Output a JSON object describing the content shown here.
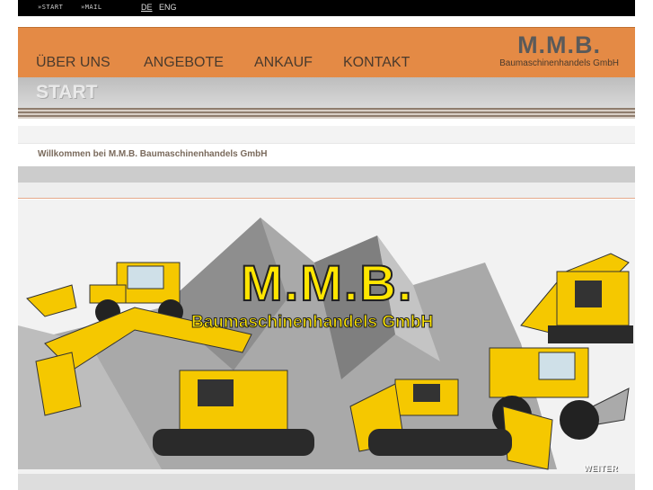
{
  "topbar": {
    "links": [
      {
        "label": "»START"
      },
      {
        "label": "»MAIL"
      }
    ],
    "languages": [
      {
        "label": "DE",
        "active": true
      },
      {
        "label": "ENG",
        "active": false
      }
    ]
  },
  "nav": {
    "items": [
      {
        "label": "ÜBER UNS"
      },
      {
        "label": "ANGEBOTE"
      },
      {
        "label": "ANKAUF"
      },
      {
        "label": "KONTAKT"
      }
    ],
    "brand_title": "M.M.B.",
    "brand_subtitle": "Baumaschinenhandels GmbH"
  },
  "page": {
    "section_title": "START",
    "welcome": "Willkommen bei M.M.B. Baumaschinenhandels GmbH"
  },
  "hero": {
    "logo_title": "M.M.B.",
    "logo_subtitle": "Baumaschinenhandels GmbH",
    "next_label": "WEITER"
  },
  "colors": {
    "nav_orange": "#e48a45",
    "machine_yellow": "#f5c800",
    "logo_yellow": "#ffe600"
  },
  "icons": [
    "excavator-image",
    "dozer-image",
    "wheel-loader-image"
  ]
}
